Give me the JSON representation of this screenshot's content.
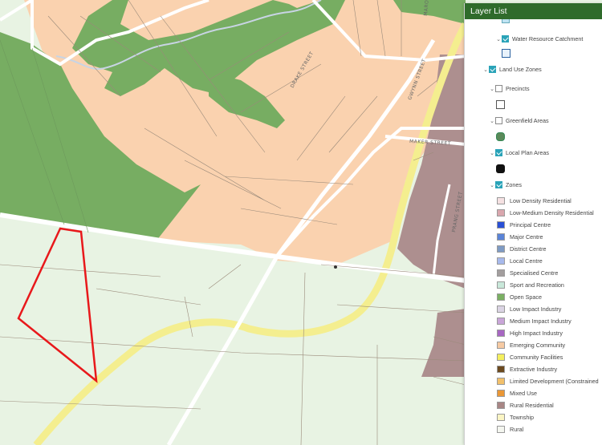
{
  "map": {
    "streets": [
      "DRAKE STREET",
      "GWYNN STREET",
      "MAKER STREET",
      "PRANG STREET",
      "MARON"
    ],
    "colors": {
      "emerging": "#fad2af",
      "open_space": "#77ad62",
      "rural": "#e8f3e3",
      "rural_residential": "#ad8f8f",
      "community": "#f4ee8f",
      "road": "#ffffff",
      "highlight": "#e8181b",
      "creek": "#c8d4e4"
    }
  },
  "layer_list": {
    "title": "Layer List",
    "water_resource": "Water Resource Catchment",
    "land_use_zones": "Land Use Zones",
    "precincts": "Precincts",
    "greenfield": "Greenfield Areas",
    "local_plan": "Local Plan Areas",
    "zones": "Zones",
    "legend": [
      {
        "label": "Low Density Residential",
        "color": "#f5e1e2"
      },
      {
        "label": "Low-Medium Density Residential",
        "color": "#d9a7ae"
      },
      {
        "label": "Principal Centre",
        "color": "#2950d6"
      },
      {
        "label": "Major Centre",
        "color": "#5a84d8"
      },
      {
        "label": "District Centre",
        "color": "#7f9bc4"
      },
      {
        "label": "Local Centre",
        "color": "#a7b9ec"
      },
      {
        "label": "Specialised Centre",
        "color": "#a39e9e"
      },
      {
        "label": "Sport and Recreation",
        "color": "#c9e8da"
      },
      {
        "label": "Open Space",
        "color": "#7bb063"
      },
      {
        "label": "Low Impact Industry",
        "color": "#dbd4e4"
      },
      {
        "label": "Medium Impact Industry",
        "color": "#c9a5d8"
      },
      {
        "label": "High Impact Industry",
        "color": "#a767c2"
      },
      {
        "label": "Emerging Community",
        "color": "#f6caa3"
      },
      {
        "label": "Community Facilities",
        "color": "#f4ef5e"
      },
      {
        "label": "Extractive Industry",
        "color": "#6c4a1f"
      },
      {
        "label": "Limited Development (Constrained",
        "color": "#f2c06b"
      },
      {
        "label": "Mixed Use",
        "color": "#ea9736"
      },
      {
        "label": "Rural Residential",
        "color": "#a88685"
      },
      {
        "label": "Township",
        "color": "#fbf5c4"
      },
      {
        "label": "Rural",
        "color": "#f4f6ef"
      }
    ]
  }
}
